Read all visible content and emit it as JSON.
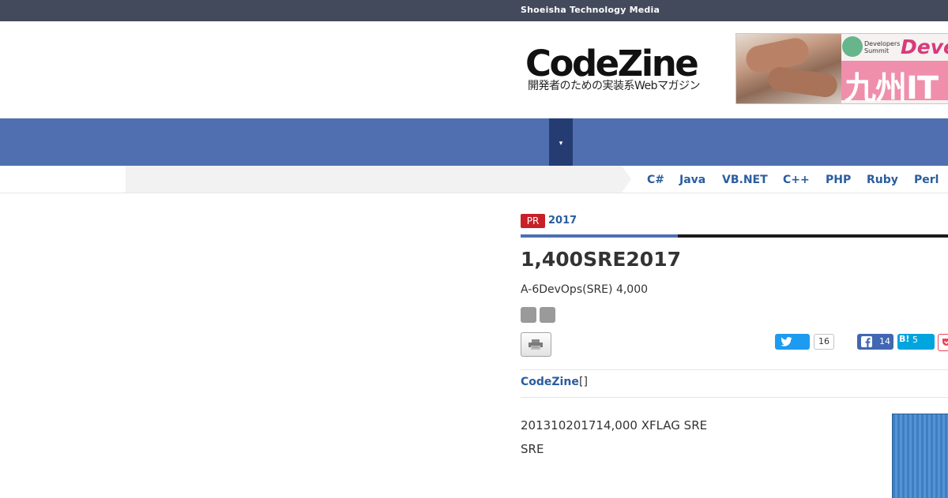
{
  "topbar": {
    "label": "Shoeisha Technology Media"
  },
  "header": {
    "logo_text": "CodeZine",
    "logo_tagline": "開発者のための実装系Webマガジン"
  },
  "ad": {
    "logo_text": "Developers Summit",
    "headline": "Deve",
    "subheadline": "九州IT"
  },
  "nav": {
    "toggle_icon": "▾"
  },
  "subnav": {
    "languages": [
      "C#",
      "Java",
      "VB.NET",
      "C++",
      "PHP",
      "Ruby",
      "Perl"
    ]
  },
  "article": {
    "badge": "PR",
    "year": "2017",
    "title": "1,400SRE2017",
    "lead": "A-6DevOps(SRE) 4,000",
    "source_link": "CodeZine",
    "source_suffix": "[]",
    "body_line1": "201310201714,000 XFLAG SRE",
    "body_line2": "SRE"
  },
  "social": {
    "twitter_count": "16",
    "facebook_count": "14",
    "hatena_label": "B!",
    "hatena_count": "5"
  },
  "colors": {
    "topbar": "#434a5c",
    "nav": "#4f6fb0",
    "nav_toggle": "#253c72",
    "link": "#2a5d9f",
    "pr_badge": "#c62029",
    "twitter": "#1d9bf0",
    "facebook": "#4267b2",
    "hatena": "#00a4de",
    "pocket": "#ef4056"
  }
}
